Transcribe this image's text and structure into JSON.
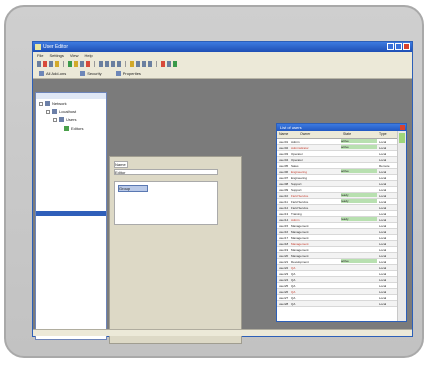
{
  "window": {
    "title": "User Editor",
    "colors": {
      "accent": "#2c5fb8",
      "chrome": "#ece9d8",
      "status_ok": "#b8e0b0",
      "status_warn": "#c23a2a"
    }
  },
  "menu": [
    "File",
    "Settings",
    "View",
    "Help"
  ],
  "toolbar2": [
    "All Add-ons",
    "Security",
    "Properties"
  ],
  "tree": [
    {
      "label": "Network"
    },
    {
      "label": "Localhost"
    },
    {
      "label": "Users"
    },
    {
      "label": "Editors"
    }
  ],
  "middle": {
    "field_label": "Name",
    "input_value": "Editor",
    "box_header": "Group"
  },
  "grid": {
    "title": "List of users",
    "headers": [
      "Name",
      "Owner",
      "State",
      "Type"
    ],
    "rows": [
      [
        "user01",
        "Admin",
        "active",
        "Local"
      ],
      [
        "user02",
        "Adminsitrator",
        "active",
        "Local"
      ],
      [
        "user03",
        "Operator",
        "",
        "Local"
      ],
      [
        "user04",
        "Operator",
        "",
        "Local"
      ],
      [
        "user05",
        "Sales",
        "",
        "Remote"
      ],
      [
        "user06",
        "Engineering",
        "active",
        "Local"
      ],
      [
        "user07",
        "Engineering",
        "",
        "Local"
      ],
      [
        "user08",
        "Support",
        "",
        "Local"
      ],
      [
        "user09",
        "Support",
        "",
        "Local"
      ],
      [
        "user10",
        "Field Service",
        "ready",
        "Local"
      ],
      [
        "user11",
        "Field Service",
        "ready",
        "Local"
      ],
      [
        "user12",
        "Field Service",
        "",
        "Local"
      ],
      [
        "user13",
        "Training",
        "",
        "Local"
      ],
      [
        "user14",
        "Admin",
        "ready",
        "Local"
      ],
      [
        "user15",
        "Management",
        "",
        "Local"
      ],
      [
        "user16",
        "Management",
        "",
        "Local"
      ],
      [
        "user17",
        "Management",
        "",
        "Local"
      ],
      [
        "user18",
        "Management",
        "",
        "Local"
      ],
      [
        "user19",
        "Management",
        "",
        "Local"
      ],
      [
        "user20",
        "Management",
        "",
        "Local"
      ],
      [
        "user21",
        "Development",
        "active",
        "Local"
      ],
      [
        "user22",
        "QA",
        "",
        "Local"
      ],
      [
        "user23",
        "QA",
        "",
        "Local"
      ],
      [
        "user24",
        "QA",
        "",
        "Local"
      ],
      [
        "user25",
        "QA",
        "",
        "Local"
      ],
      [
        "user26",
        "QA",
        "",
        "Local"
      ],
      [
        "user27",
        "QA",
        "",
        "Local"
      ],
      [
        "user28",
        "QA",
        "",
        "Local"
      ]
    ]
  }
}
